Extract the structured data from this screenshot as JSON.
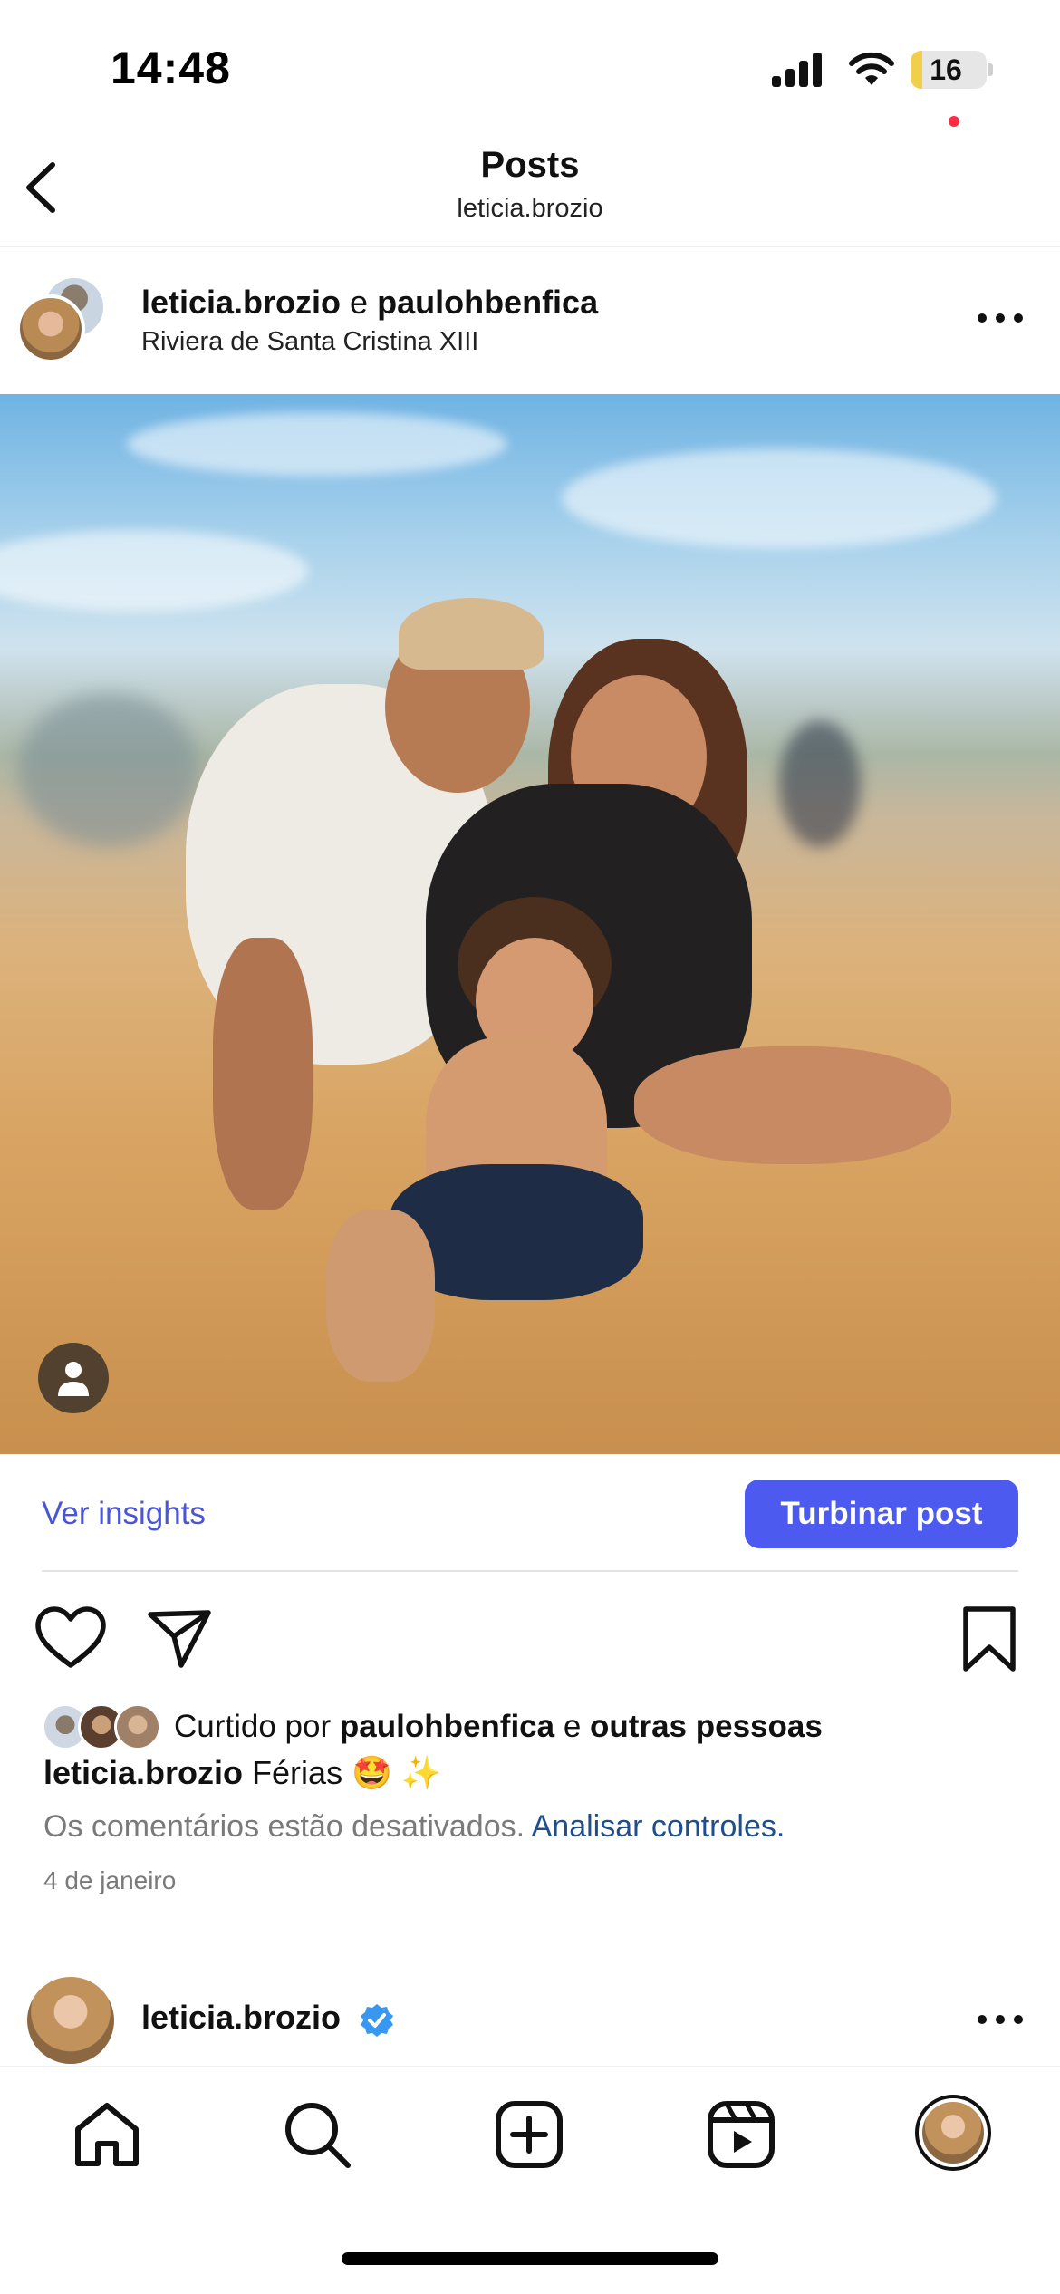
{
  "status_bar": {
    "time": "14:48",
    "battery": "16",
    "battery_level": 0.16
  },
  "header": {
    "title": "Posts",
    "subtitle": "leticia.brozio"
  },
  "post": {
    "author": "leticia.brozio",
    "connector": " e ",
    "coauthor": "paulohbenfica",
    "location": "Riviera de Santa Cristina XIII",
    "insights_label": "Ver insights",
    "boost_label": "Turbinar post",
    "likes_prefix": "Curtido por ",
    "likes_user": "paulohbenfica",
    "likes_connector": " e ",
    "likes_others": "outras pessoas",
    "caption_user": "leticia.brozio",
    "caption_text": " Férias 🤩 ✨",
    "comments_off": "Os comentários estão desativados. ",
    "comments_link": "Analisar controles.",
    "date": "4 de janeiro"
  },
  "next_post": {
    "author": "leticia.brozio"
  },
  "colors": {
    "accent": "#4d5aef",
    "link": "#1e4e8c",
    "notification": "#ff2d43",
    "verified": "#3897f0"
  },
  "icons": [
    "signal-icon",
    "wifi-icon",
    "back-icon",
    "more-icon",
    "tag-user-icon",
    "heart-icon",
    "share-icon",
    "bookmark-icon",
    "verified-icon",
    "home-icon",
    "search-icon",
    "create-icon",
    "reels-icon"
  ]
}
